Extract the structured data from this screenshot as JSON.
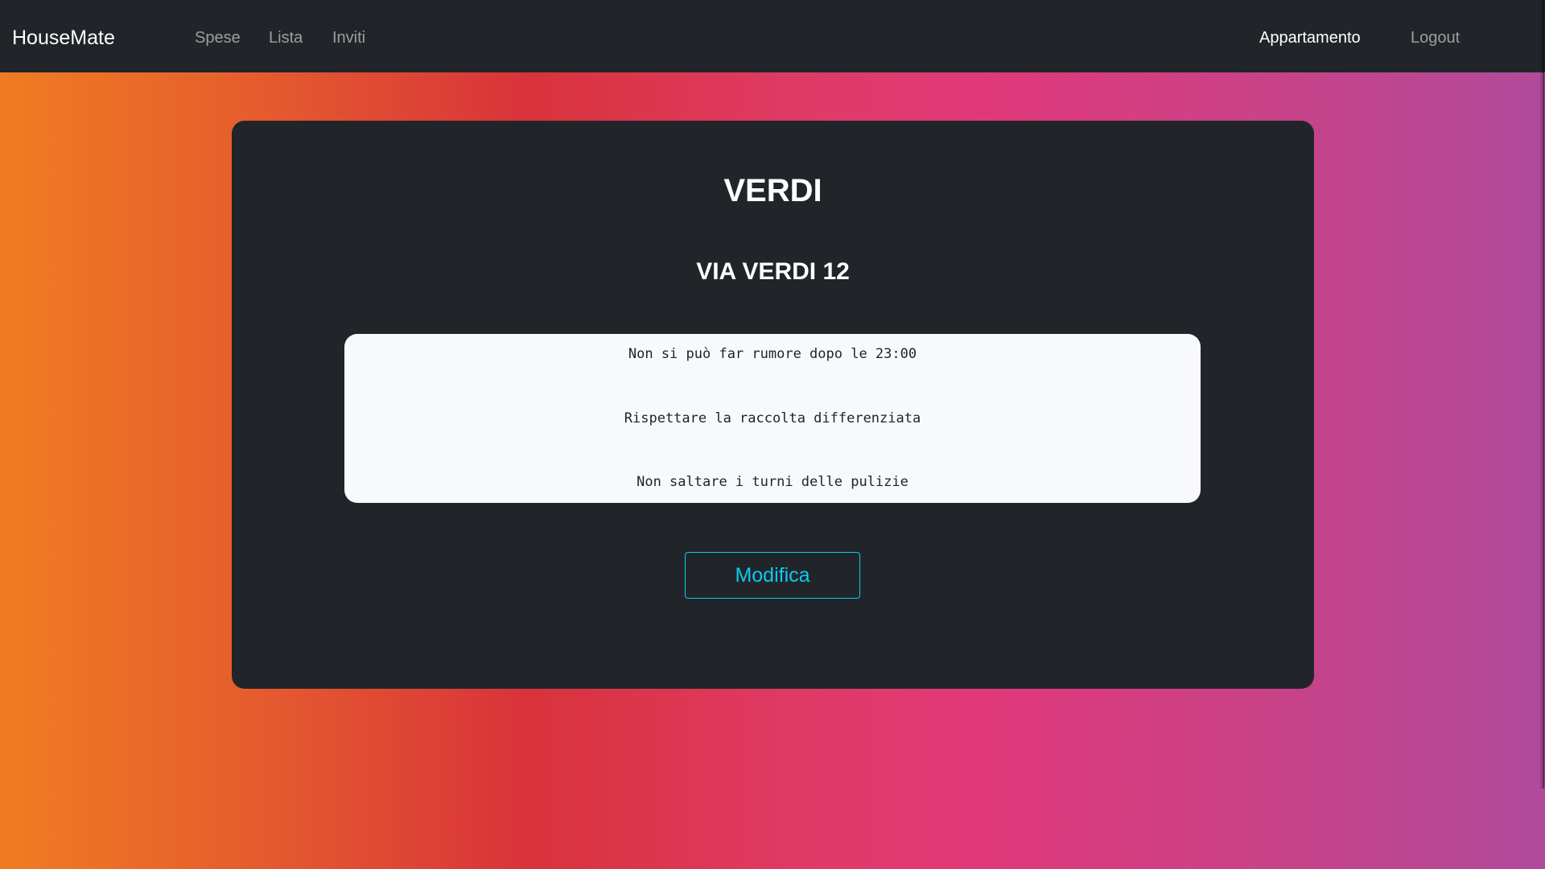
{
  "navbar": {
    "brand": "HouseMate",
    "links": [
      {
        "label": "Spese"
      },
      {
        "label": "Lista"
      },
      {
        "label": "Inviti"
      }
    ],
    "right_links": [
      {
        "label": "Appartamento",
        "active": true
      },
      {
        "label": "Logout"
      }
    ]
  },
  "apartment": {
    "name": "VERDI",
    "address": "VIA VERDI 12",
    "rules": [
      "Non si può far rumore dopo le 23:00",
      "Rispettare la raccolta differenziata",
      "Non saltare i turni delle pulizie"
    ],
    "edit_label": "Modifica"
  },
  "colors": {
    "navbar_bg": "#212529",
    "card_bg": "#212529",
    "rules_bg": "#f8f9fa",
    "accent": "#0dcaf0",
    "gradient": [
      "#f07c22",
      "#d8333a",
      "#e0397a",
      "#b04a9a"
    ]
  }
}
